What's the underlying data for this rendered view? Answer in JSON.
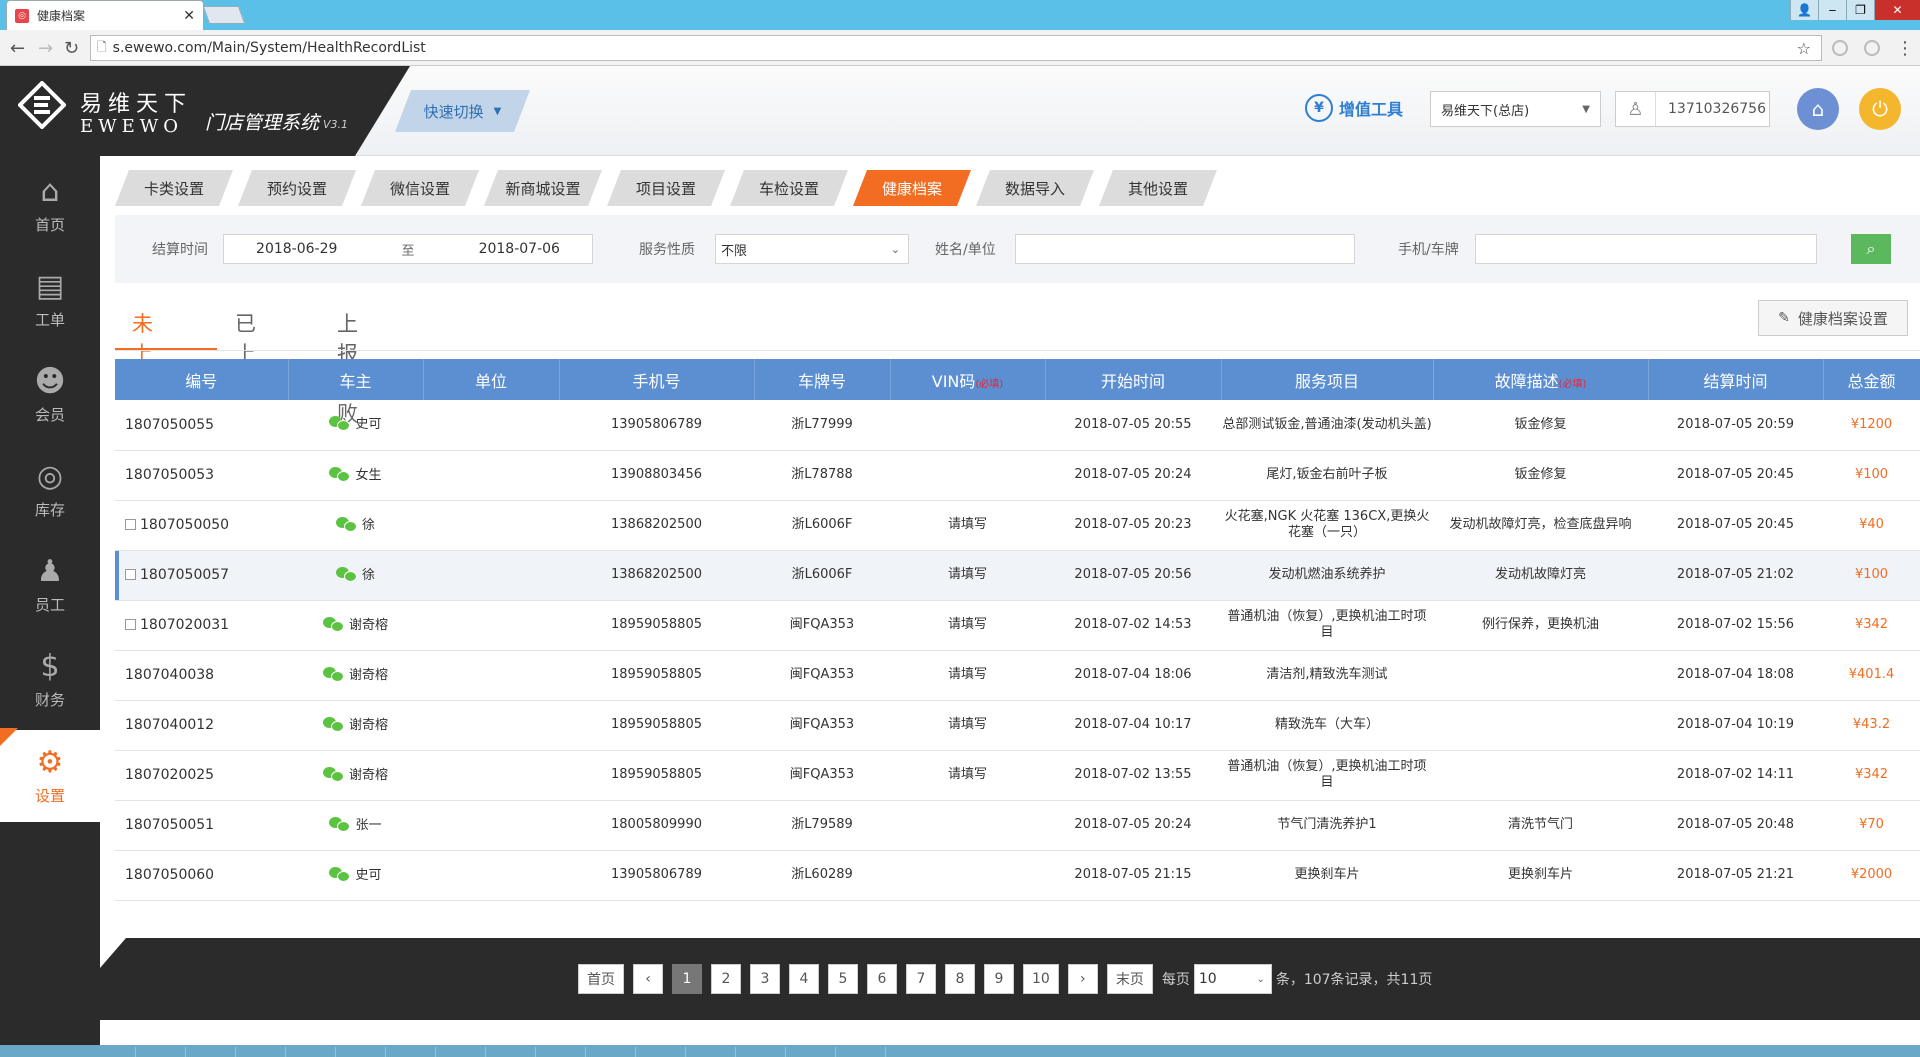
{
  "browser": {
    "tab_title": "健康档案",
    "url": "s.ewewo.com/Main/System/HealthRecordList"
  },
  "header": {
    "logo_cn": "易维天下",
    "logo_en": "EWEWO",
    "system_name": "门店管理系统",
    "version": "V3.1",
    "quick_switch": "快速切换",
    "tools_label": "增值工具",
    "store": "易维天下(总店)",
    "user_phone": "13710326756"
  },
  "sidebar": {
    "items": [
      {
        "label": "首页",
        "icon": "home-icon"
      },
      {
        "label": "工单",
        "icon": "work-order-icon"
      },
      {
        "label": "会员",
        "icon": "member-icon"
      },
      {
        "label": "库存",
        "icon": "inventory-icon"
      },
      {
        "label": "员工",
        "icon": "staff-icon"
      },
      {
        "label": "财务",
        "icon": "finance-icon"
      },
      {
        "label": "设置",
        "icon": "gear-icon"
      }
    ]
  },
  "settings_tabs": [
    "卡类设置",
    "预约设置",
    "微信设置",
    "新商城设置",
    "项目设置",
    "车检设置",
    "健康档案",
    "数据导入",
    "其他设置"
  ],
  "filters": {
    "settle_time_label": "结算时间",
    "date_from": "2018-06-29",
    "date_to_sep": "至",
    "date_to": "2018-07-06",
    "service_type_label": "服务性质",
    "service_type_value": "不限",
    "name_label": "姓名/单位",
    "phone_label": "手机/车牌"
  },
  "report_tabs": [
    "未上报",
    "已上报",
    "上报失败"
  ],
  "health_settings_btn": "健康档案设置",
  "table": {
    "headers": [
      "编号",
      "车主",
      "单位",
      "手机号",
      "车牌号",
      "VIN码",
      "开始时间",
      "服务项目",
      "故障描述",
      "结算时间",
      "总金额"
    ],
    "required_tag": "(必填)",
    "rows": [
      {
        "id": "1807050055",
        "owner": "史可",
        "unit": "",
        "phone": "13905806789",
        "plate": "浙L77999",
        "vin": "",
        "start": "2018-07-05 20:55",
        "service": "总部测试钣金,普通油漆(发动机头盖)",
        "fault": "钣金修复",
        "settle": "2018-07-05 20:59",
        "amount": "¥1200",
        "checkbox": false
      },
      {
        "id": "1807050053",
        "owner": "女生",
        "unit": "",
        "phone": "13908803456",
        "plate": "浙L78788",
        "vin": "",
        "start": "2018-07-05 20:24",
        "service": "尾灯,钣金右前叶子板",
        "fault": "钣金修复",
        "settle": "2018-07-05 20:45",
        "amount": "¥100",
        "checkbox": false
      },
      {
        "id": "1807050050",
        "owner": "徐",
        "unit": "",
        "phone": "13868202500",
        "plate": "浙L6006F",
        "vin": "请填写",
        "start": "2018-07-05 20:23",
        "service": "火花塞,NGK 火花塞 136CX,更换火花塞（一只）",
        "fault": "发动机故障灯亮，检查底盘异响",
        "settle": "2018-07-05 20:45",
        "amount": "¥40",
        "checkbox": true
      },
      {
        "id": "1807050057",
        "owner": "徐",
        "unit": "",
        "phone": "13868202500",
        "plate": "浙L6006F",
        "vin": "请填写",
        "start": "2018-07-05 20:56",
        "service": "发动机燃油系统养护",
        "fault": "发动机故障灯亮",
        "settle": "2018-07-05 21:02",
        "amount": "¥100",
        "checkbox": true
      },
      {
        "id": "1807020031",
        "owner": "谢奇榕",
        "unit": "",
        "phone": "18959058805",
        "plate": "闽FQA353",
        "vin": "请填写",
        "start": "2018-07-02 14:53",
        "service": "普通机油（恢复）,更换机油工时项目",
        "fault": "例行保养，更换机油",
        "settle": "2018-07-02 15:56",
        "amount": "¥342",
        "checkbox": true
      },
      {
        "id": "1807040038",
        "owner": "谢奇榕",
        "unit": "",
        "phone": "18959058805",
        "plate": "闽FQA353",
        "vin": "请填写",
        "start": "2018-07-04 18:06",
        "service": "清洁剂,精致洗车测试",
        "fault": "",
        "settle": "2018-07-04 18:08",
        "amount": "¥401.4",
        "checkbox": false
      },
      {
        "id": "1807040012",
        "owner": "谢奇榕",
        "unit": "",
        "phone": "18959058805",
        "plate": "闽FQA353",
        "vin": "请填写",
        "start": "2018-07-04 10:17",
        "service": "精致洗车（大车）",
        "fault": "",
        "settle": "2018-07-04 10:19",
        "amount": "¥43.2",
        "checkbox": false
      },
      {
        "id": "1807020025",
        "owner": "谢奇榕",
        "unit": "",
        "phone": "18959058805",
        "plate": "闽FQA353",
        "vin": "请填写",
        "start": "2018-07-02 13:55",
        "service": "普通机油（恢复）,更换机油工时项目",
        "fault": "",
        "settle": "2018-07-02 14:11",
        "amount": "¥342",
        "checkbox": false
      },
      {
        "id": "1807050051",
        "owner": "张一",
        "unit": "",
        "phone": "18005809990",
        "plate": "浙L79589",
        "vin": "",
        "start": "2018-07-05 20:24",
        "service": "节气门清洗养护1",
        "fault": "清洗节气门",
        "settle": "2018-07-05 20:48",
        "amount": "¥70",
        "checkbox": false
      },
      {
        "id": "1807050060",
        "owner": "史可",
        "unit": "",
        "phone": "13905806789",
        "plate": "浙L60289",
        "vin": "",
        "start": "2018-07-05 21:15",
        "service": "更换刹车片",
        "fault": "更换刹车片",
        "settle": "2018-07-05 21:21",
        "amount": "¥2000",
        "checkbox": false
      }
    ]
  },
  "pagination": {
    "first": "首页",
    "prev": "‹",
    "pages": [
      "1",
      "2",
      "3",
      "4",
      "5",
      "6",
      "7",
      "8",
      "9",
      "10"
    ],
    "current": "1",
    "next": "›",
    "last": "末页",
    "per_page_label": "每页",
    "per_page_value": "10",
    "summary": "条，107条记录，共11页"
  },
  "colors": {
    "accent_orange": "#f26d21",
    "header_blue": "#5b8fd1",
    "sidebar_dark": "#2b2b2b",
    "search_green": "#5cb85c"
  }
}
